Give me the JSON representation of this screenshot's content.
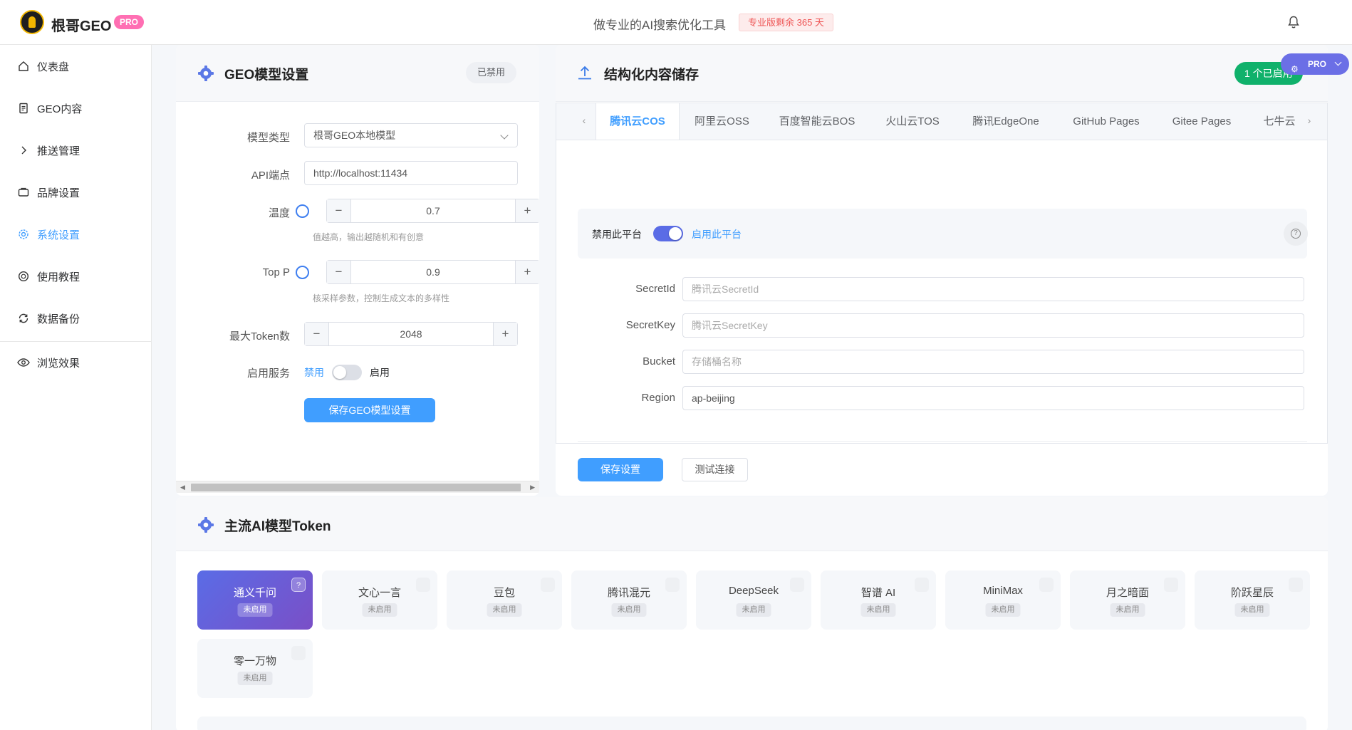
{
  "header": {
    "brand": "根哥GEO",
    "pro_badge": "PRO",
    "slogan": "做专业的AI搜索优化工具",
    "subscription": "专业版剩余 365 天"
  },
  "sidebar": {
    "items": [
      {
        "label": "仪表盘",
        "icon": "home-icon"
      },
      {
        "label": "GEO内容",
        "icon": "document-icon"
      },
      {
        "label": "推送管理",
        "icon": "chevron-right-icon"
      },
      {
        "label": "品牌设置",
        "icon": "brand-icon"
      },
      {
        "label": "系统设置",
        "icon": "gear-icon",
        "active": true
      },
      {
        "label": "使用教程",
        "icon": "help-circle-icon"
      },
      {
        "label": "数据备份",
        "icon": "refresh-icon"
      },
      {
        "label": "浏览效果",
        "icon": "eye-icon"
      }
    ]
  },
  "geo": {
    "title": "GEO模型设置",
    "status_tag": "已禁用",
    "model_type_label": "模型类型",
    "model_type_value": "根哥GEO本地模型",
    "api_label": "API端点",
    "api_value": "http://localhost:11434",
    "temp_label": "温度",
    "temp_value": "0.7",
    "temp_hint": "值越高，输出越随机和有创意",
    "topp_label": "Top P",
    "topp_value": "0.9",
    "topp_hint": "核采样参数，控制生成文本的多样性",
    "maxtoken_label": "最大Token数",
    "maxtoken_value": "2048",
    "service_label": "启用服务",
    "service_off": "禁用",
    "service_on": "启用",
    "save_button": "保存GEO模型设置"
  },
  "storage": {
    "title": "结构化内容储存",
    "enabled_count": "1 个已启用",
    "pro_float": "PRO",
    "tabs": [
      "腾讯云COS",
      "阿里云OSS",
      "百度智能云BOS",
      "火山云TOS",
      "腾讯EdgeOne",
      "GitHub Pages",
      "Gitee Pages",
      "七牛云"
    ],
    "active_tab": 0,
    "platform_off": "禁用此平台",
    "platform_on": "启用此平台",
    "fields": [
      {
        "label": "SecretId",
        "value": "",
        "placeholder": "腾讯云SecretId"
      },
      {
        "label": "SecretKey",
        "value": "",
        "placeholder": "腾讯云SecretKey"
      },
      {
        "label": "Bucket",
        "value": "",
        "placeholder": "存储桶名称"
      },
      {
        "label": "Region",
        "value": "ap-beijing",
        "placeholder": ""
      }
    ],
    "save_button": "保存设置",
    "test_button": "测试连接"
  },
  "tokens": {
    "title": "主流AI模型Token",
    "models": [
      {
        "name": "通义千问",
        "status": "未启用",
        "active": true
      },
      {
        "name": "文心一言",
        "status": "未启用"
      },
      {
        "name": "豆包",
        "status": "未启用"
      },
      {
        "name": "腾讯混元",
        "status": "未启用"
      },
      {
        "name": "DeepSeek",
        "status": "未启用"
      },
      {
        "name": "智谱 AI",
        "status": "未启用"
      },
      {
        "name": "MiniMax",
        "status": "未启用"
      },
      {
        "name": "月之暗面",
        "status": "未启用"
      },
      {
        "name": "阶跃星辰",
        "status": "未启用"
      },
      {
        "name": "零一万物",
        "status": "未启用"
      }
    ]
  },
  "colors": {
    "primary": "#409eff",
    "success": "#10b16b",
    "pro_pink": "#ff6fb3",
    "pro_purple": "#6b6fe6"
  }
}
